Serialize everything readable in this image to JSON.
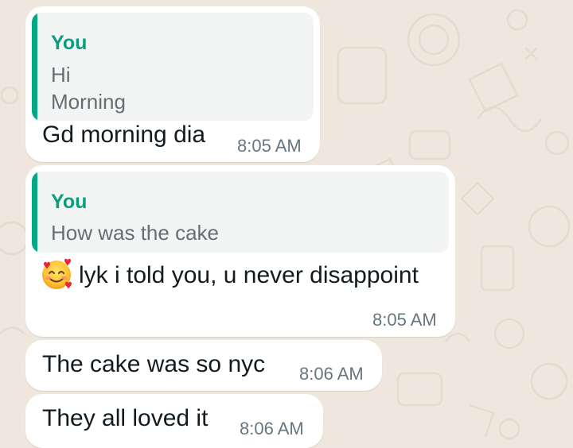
{
  "chat": {
    "messages": [
      {
        "reply": {
          "author": "You",
          "lines": [
            "Hi",
            "Morning"
          ]
        },
        "text": "Gd morning dia",
        "time": "8:05 AM"
      },
      {
        "reply": {
          "author": "You",
          "lines": [
            "How was the cake"
          ]
        },
        "emoji": "smiling-face-with-hearts-icon",
        "text": "lyk i told you, u never disappoint",
        "time": "8:05 AM"
      },
      {
        "text": "The cake was so nyc",
        "time": "8:06 AM"
      },
      {
        "text": "They all loved it",
        "time": "8:06 AM"
      }
    ]
  },
  "colors": {
    "background": "#EFE7DE",
    "bubble": "#FFFFFF",
    "reply_accent": "#06A884",
    "reply_author": "#0A9E7E"
  }
}
